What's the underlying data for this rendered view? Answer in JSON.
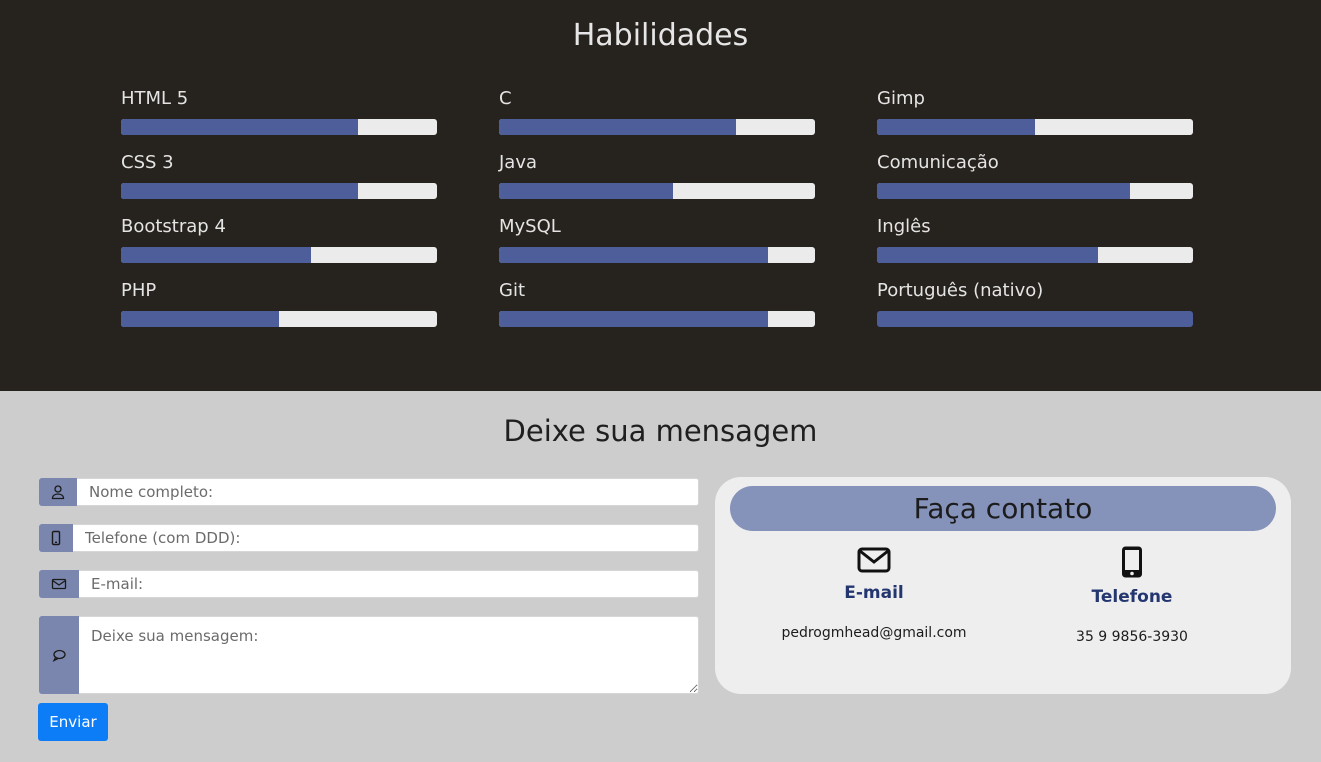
{
  "skills": {
    "title": "Habilidades",
    "items": [
      {
        "label": "HTML 5",
        "level": 0.75
      },
      {
        "label": "C",
        "level": 0.75
      },
      {
        "label": "Gimp",
        "level": 0.5
      },
      {
        "label": "CSS 3",
        "level": 0.75
      },
      {
        "label": "Java",
        "level": 0.55
      },
      {
        "label": "Comunicação",
        "level": 0.8
      },
      {
        "label": "Bootstrap 4",
        "level": 0.6
      },
      {
        "label": "MySQL",
        "level": 0.85
      },
      {
        "label": "Inglês",
        "level": 0.7
      },
      {
        "label": "PHP",
        "level": 0.5
      },
      {
        "label": "Git",
        "level": 0.85
      },
      {
        "label": "Português (nativo)",
        "level": 1.0
      }
    ],
    "colors": {
      "fill": "#4d5e9a",
      "track": "#ebebeb"
    }
  },
  "message": {
    "title": "Deixe sua mensagem",
    "fields": {
      "name_placeholder": "Nome completo:",
      "phone_placeholder": "Telefone (com DDD):",
      "email_placeholder": "E-mail:",
      "message_placeholder": "Deixe sua mensagem:"
    },
    "send_label": "Enviar"
  },
  "contact": {
    "title": "Faça contato",
    "email": {
      "title": "E-mail",
      "value": "pedrogmhead@gmail.com",
      "icon": "envelope-icon"
    },
    "phone": {
      "title": "Telefone",
      "value": "35 9 9856-3930",
      "icon": "mobile-phone-icon"
    }
  }
}
